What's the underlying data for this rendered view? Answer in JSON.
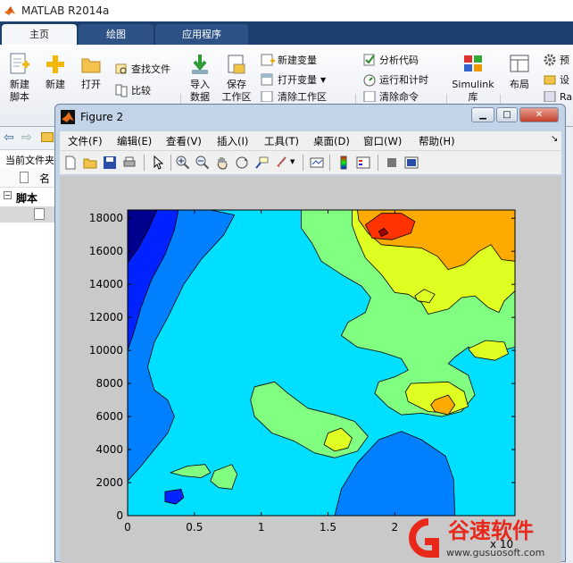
{
  "app": {
    "title": "MATLAB R2014a"
  },
  "tabs": [
    {
      "label": "主页"
    },
    {
      "label": "绘图"
    },
    {
      "label": "应用程序"
    }
  ],
  "ribbon": {
    "new_script": "新建\n脚本",
    "new": "新建",
    "open": "打开",
    "find_files": "查找文件",
    "compare": "比较",
    "import_data": "导入\n数据",
    "save_workspace": "保存\n工作区",
    "new_variable": "新建变量",
    "open_variable": "打开变量",
    "clear_workspace": "清除工作区",
    "analyze_code": "分析代码",
    "run_and_time": "运行和计时",
    "clear_commands": "清除命令",
    "simulink": "Simulink\n库",
    "layout": "布局",
    "preferences": "预",
    "set_path": "设",
    "parallel": "Ra"
  },
  "left": {
    "current_folder": "当前文件夹",
    "name_col": "名",
    "scripts_group": "脚本"
  },
  "figure": {
    "title": "Figure 2",
    "menu": [
      {
        "label": "文件(F)"
      },
      {
        "label": "编辑(E)"
      },
      {
        "label": "查看(V)"
      },
      {
        "label": "插入(I)"
      },
      {
        "label": "工具(T)"
      },
      {
        "label": "桌面(D)"
      },
      {
        "label": "窗口(W)"
      },
      {
        "label": "帮助(H)"
      }
    ],
    "menu_arrow": "↘"
  },
  "chart_data": {
    "type": "contourf",
    "xlim": [
      0,
      2.9
    ],
    "ylim": [
      0,
      18500
    ],
    "xticks": [
      "0",
      "0.5",
      "1",
      "1.5",
      "2"
    ],
    "yticks": [
      "0",
      "2000",
      "4000",
      "6000",
      "8000",
      "10000",
      "12000",
      "14000",
      "16000",
      "18000"
    ],
    "x_exponent_label": "x 10",
    "levels": [
      {
        "level": 1,
        "color": "#00008f"
      },
      {
        "level": 2,
        "color": "#0022ff"
      },
      {
        "level": 3,
        "color": "#0080ff"
      },
      {
        "level": 4,
        "color": "#00dfff"
      },
      {
        "level": 5,
        "color": "#80ff80"
      },
      {
        "level": 6,
        "color": "#dfff22"
      },
      {
        "level": 7,
        "color": "#ffaa00"
      },
      {
        "level": 8,
        "color": "#ff3300"
      },
      {
        "level": 9,
        "color": "#a00000"
      }
    ]
  },
  "watermark": {
    "brand": "谷速软件",
    "url": "www.gusuosoft.com",
    "brand_color": "#e8281b"
  }
}
